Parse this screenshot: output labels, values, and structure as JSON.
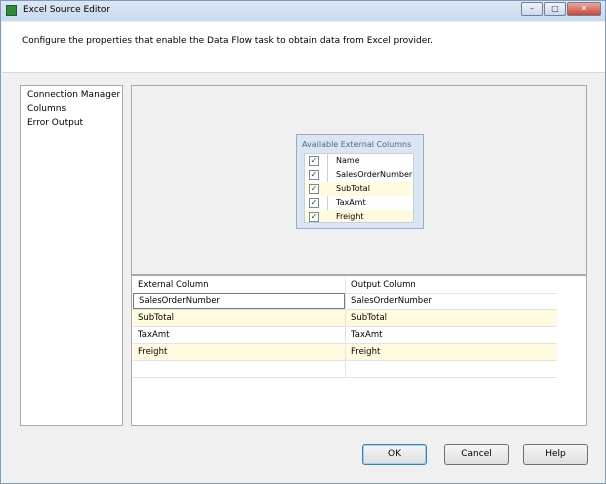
{
  "window": {
    "title": "Excel Source Editor",
    "icon": "excel-icon",
    "controls": {
      "minimize": "–",
      "maximize": "□",
      "close": "✕"
    }
  },
  "header": {
    "description": "Configure the properties that enable the Data Flow task to obtain data from Excel provider."
  },
  "nav": {
    "items": [
      "Connection Manager",
      "Columns",
      "Error Output"
    ]
  },
  "available_columns": {
    "title": "Available External Columns",
    "header": {
      "checked": true,
      "label": "Name"
    },
    "rows": [
      {
        "checked": true,
        "name": "SalesOrderNumber"
      },
      {
        "checked": true,
        "name": "SubTotal"
      },
      {
        "checked": true,
        "name": "TaxAmt"
      },
      {
        "checked": true,
        "name": "Freight"
      }
    ],
    "check_glyph": "✓"
  },
  "mapping_grid": {
    "headers": [
      "External Column",
      "Output Column"
    ],
    "rows": [
      {
        "external": "SalesOrderNumber",
        "output": "SalesOrderNumber"
      },
      {
        "external": "SubTotal",
        "output": "SubTotal"
      },
      {
        "external": "TaxAmt",
        "output": "TaxAmt"
      },
      {
        "external": "Freight",
        "output": "Freight"
      }
    ]
  },
  "buttons": {
    "ok": "OK",
    "cancel": "Cancel",
    "help": "Help"
  },
  "colors": {
    "row_highlight": "#fffbe0",
    "list_border": "#98aac4"
  }
}
